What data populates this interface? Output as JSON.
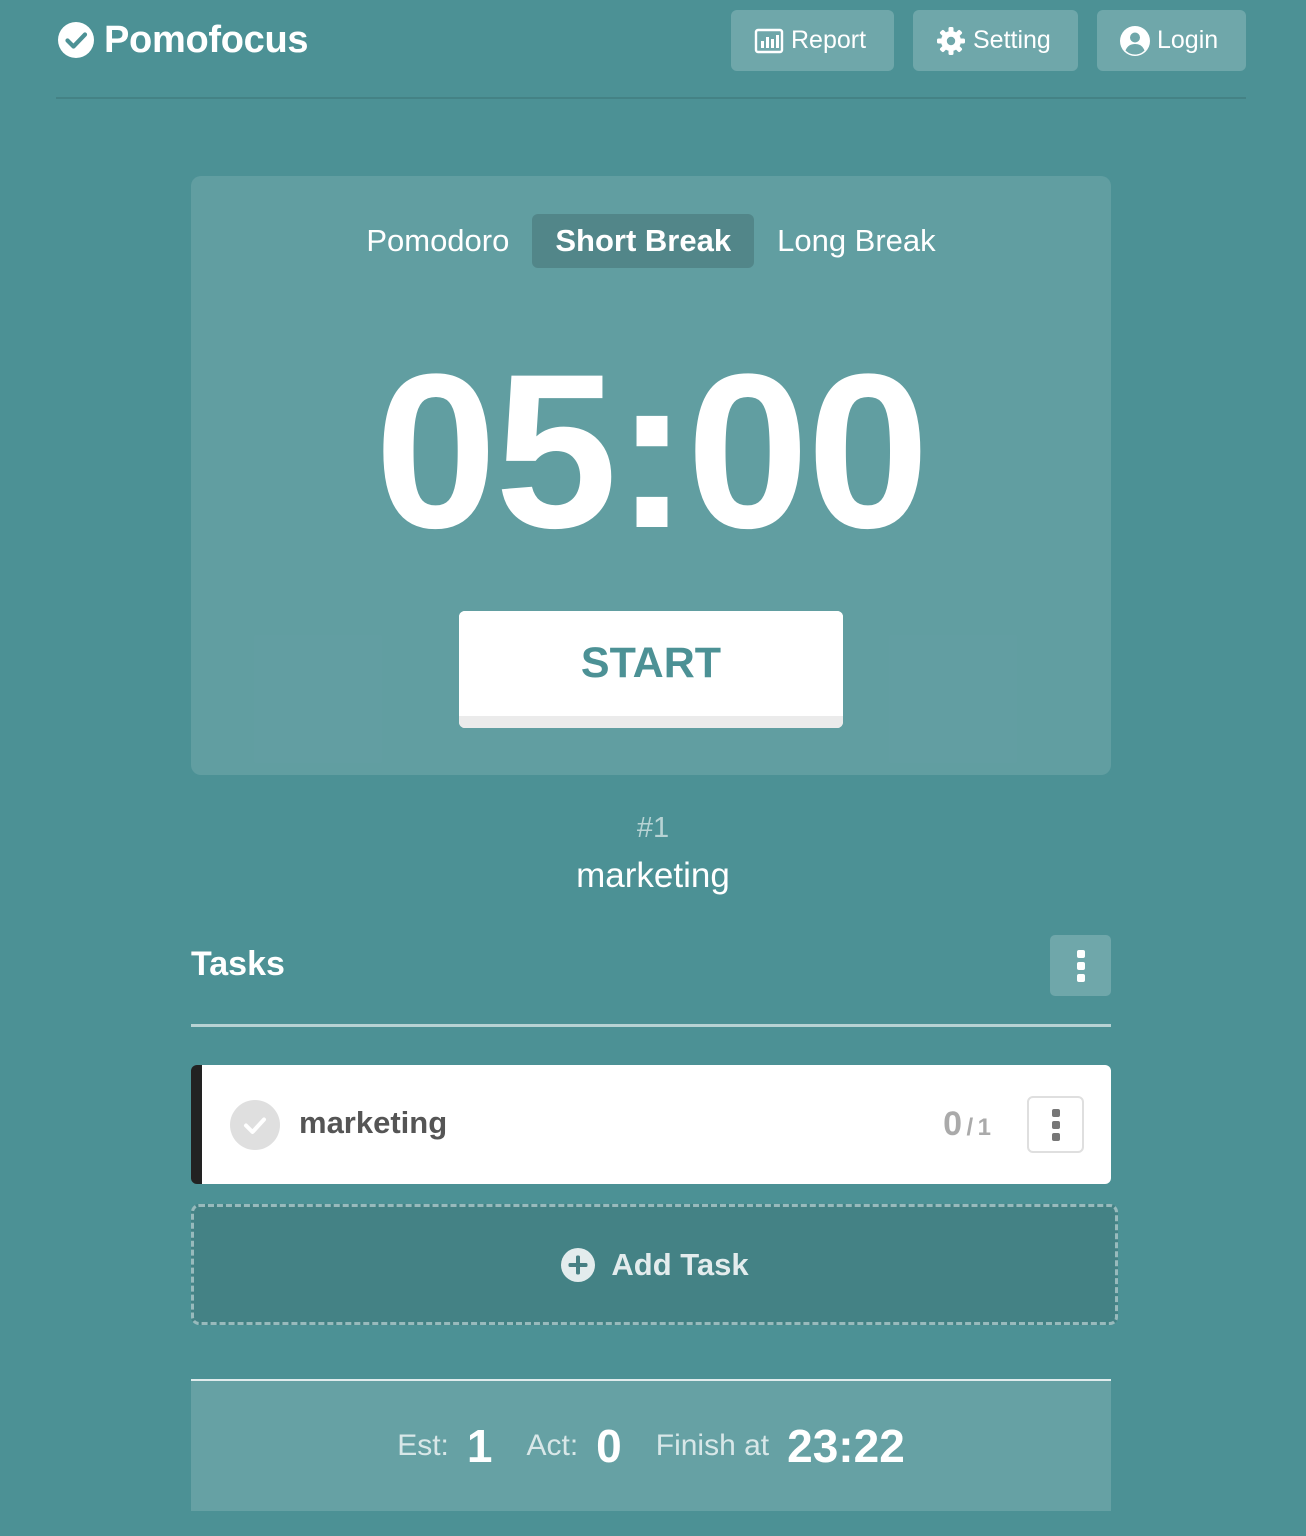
{
  "brand": {
    "name": "Pomofocus",
    "icon": "check-circle-icon"
  },
  "nav": {
    "report": {
      "label": "Report",
      "icon": "bar-chart-icon"
    },
    "setting": {
      "label": "Setting",
      "icon": "gear-icon"
    },
    "login": {
      "label": "Login",
      "icon": "user-circle-icon"
    }
  },
  "timer": {
    "tabs": [
      {
        "label": "Pomodoro",
        "active": false
      },
      {
        "label": "Short Break",
        "active": true
      },
      {
        "label": "Long Break",
        "active": false
      }
    ],
    "time": "05:00",
    "start_label": "START"
  },
  "current_task": {
    "number": "#1",
    "name": "marketing"
  },
  "tasks": {
    "title": "Tasks",
    "items": [
      {
        "name": "marketing",
        "done_count": "0",
        "separator": "/",
        "estimate": "1"
      }
    ],
    "add_label": "Add Task"
  },
  "summary": {
    "est_label": "Est:",
    "est_value": "1",
    "act_label": "Act:",
    "act_value": "0",
    "finish_label": "Finish at",
    "finish_value": "23:22"
  },
  "colors": {
    "background": "#4c9195",
    "start_text": "#4c9195",
    "task_border": "#222222"
  }
}
